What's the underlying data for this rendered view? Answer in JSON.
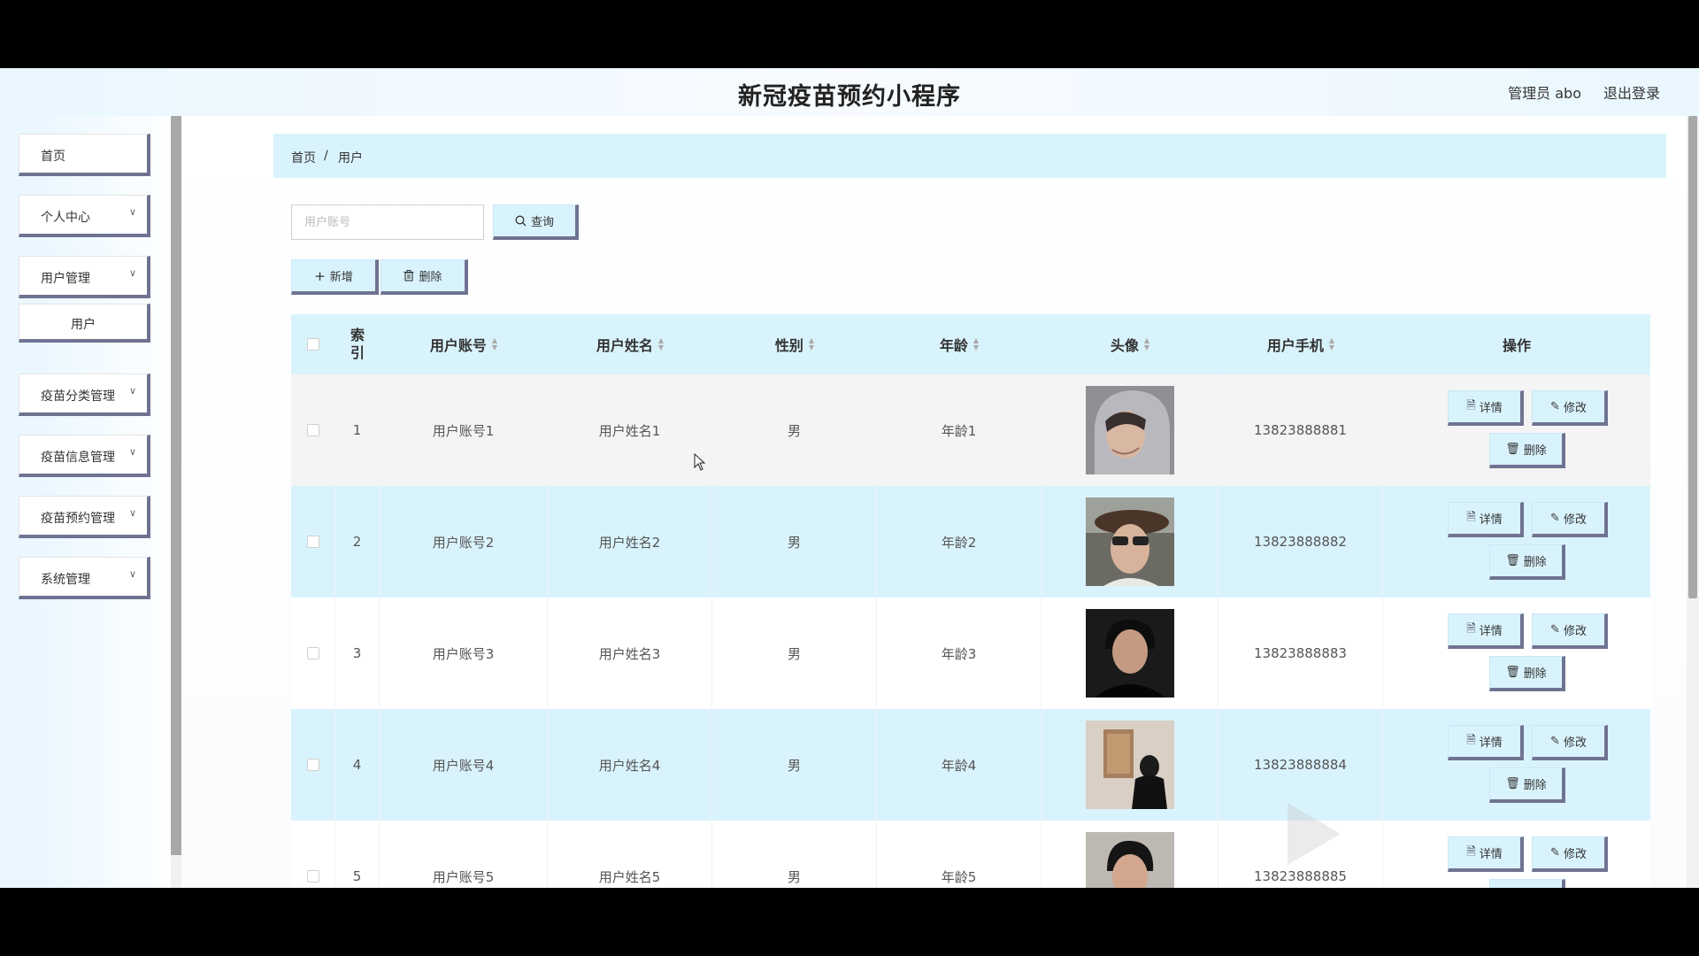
{
  "header": {
    "title": "新冠疫苗预约小程序",
    "user_info": "管理员 abo",
    "logout": "退出登录"
  },
  "sidebar": {
    "items": [
      {
        "label": "首页"
      },
      {
        "label": "个人中心"
      },
      {
        "label": "用户管理"
      },
      {
        "label": "用户"
      },
      {
        "label": "疫苗分类管理"
      },
      {
        "label": "疫苗信息管理"
      },
      {
        "label": "疫苗预约管理"
      },
      {
        "label": "系统管理"
      }
    ]
  },
  "breadcrumb": {
    "home": "首页",
    "sep": "/",
    "current": "用户"
  },
  "search": {
    "placeholder": "用户账号",
    "button": "查询"
  },
  "actions": {
    "add": "新增",
    "delete": "删除"
  },
  "table": {
    "headers": {
      "index_line1": "索",
      "index_line2": "引",
      "account": "用户账号",
      "name": "用户姓名",
      "gender": "性别",
      "age": "年龄",
      "avatar": "头像",
      "phone": "用户手机",
      "ops": "操作"
    },
    "rows": [
      {
        "index": "1",
        "account": "用户账号1",
        "name": "用户姓名1",
        "gender": "男",
        "age": "年龄1",
        "phone": "13823888881"
      },
      {
        "index": "2",
        "account": "用户账号2",
        "name": "用户姓名2",
        "gender": "男",
        "age": "年龄2",
        "phone": "13823888882"
      },
      {
        "index": "3",
        "account": "用户账号3",
        "name": "用户姓名3",
        "gender": "男",
        "age": "年龄3",
        "phone": "13823888883"
      },
      {
        "index": "4",
        "account": "用户账号4",
        "name": "用户姓名4",
        "gender": "男",
        "age": "年龄4",
        "phone": "13823888884"
      },
      {
        "index": "5",
        "account": "用户账号5",
        "name": "用户姓名5",
        "gender": "男",
        "age": "年龄5",
        "phone": "13823888885"
      }
    ],
    "op_labels": {
      "detail": "详情",
      "edit": "修改",
      "delete": "删除"
    }
  },
  "colors": {
    "accent": "#d9f3fd",
    "button_shadow": "#6f7391"
  }
}
